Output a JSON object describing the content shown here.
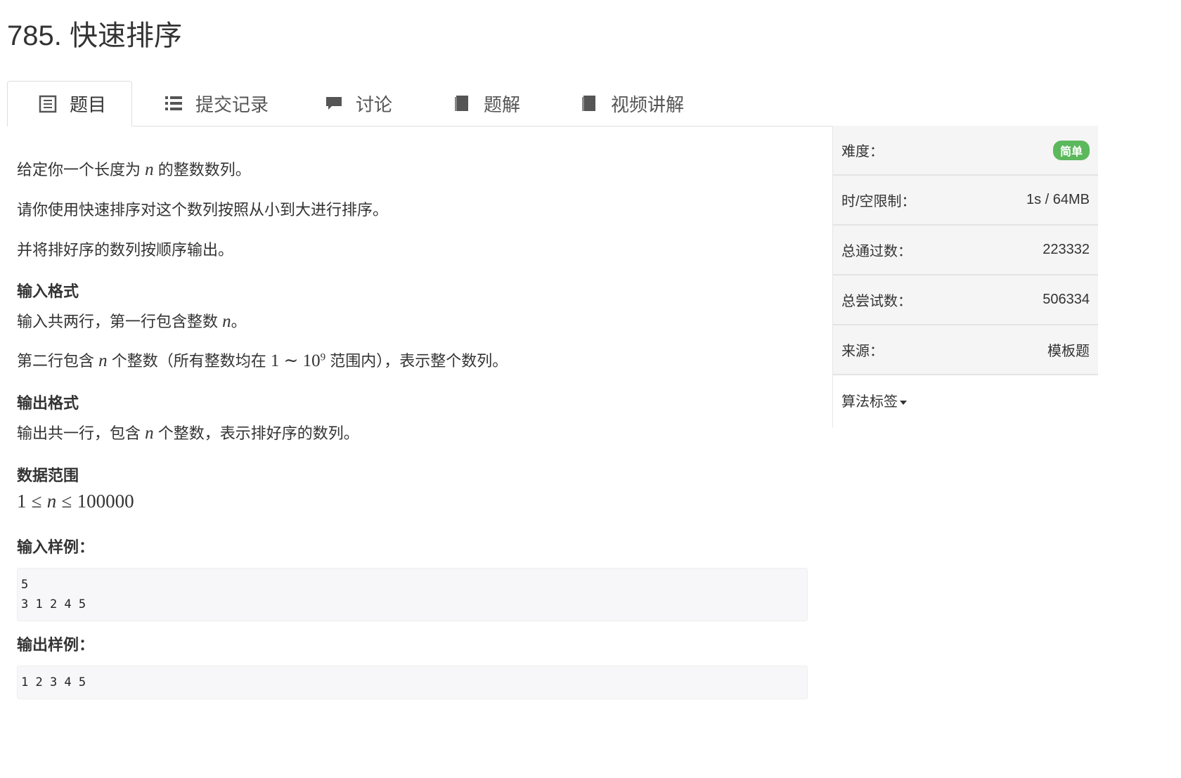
{
  "problem": {
    "title": "785. 快速排序"
  },
  "tabs": [
    {
      "label": "题目",
      "icon": "document-icon"
    },
    {
      "label": "提交记录",
      "icon": "list-icon"
    },
    {
      "label": "讨论",
      "icon": "comment-icon"
    },
    {
      "label": "题解",
      "icon": "book-icon"
    },
    {
      "label": "视频讲解",
      "icon": "book-icon"
    }
  ],
  "description": {
    "p1_before": "给定你一个长度为",
    "p1_var": "n",
    "p1_after": "的整数数列。",
    "p2": "请你使用快速排序对这个数列按照从小到大进行排序。",
    "p3": "并将排好序的数列按顺序输出。"
  },
  "input_format": {
    "heading": "输入格式",
    "line1_before": "输入共两行，第一行包含整数",
    "line1_var": "n",
    "line1_after": "。",
    "line2_before": "第二行包含",
    "line2_var": "n",
    "line2_mid": "个整数（所有整数均在",
    "line2_math_start": "1",
    "line2_math_tilde": "∼",
    "line2_math_base": "10",
    "line2_math_exp": "9",
    "line2_after": "范围内），表示整个数列。"
  },
  "output_format": {
    "heading": "输出格式",
    "line_before": "输出共一行，包含",
    "line_var": "n",
    "line_after": "个整数，表示排好序的数列。"
  },
  "data_range": {
    "heading": "数据范围",
    "math_lo": "1",
    "math_le1": "≤",
    "math_var": "n",
    "math_le2": "≤",
    "math_hi": "100000"
  },
  "sample_input": {
    "heading": "输入样例：",
    "text": "5\n3 1 2 4 5"
  },
  "sample_output": {
    "heading": "输出样例：",
    "text": "1 2 3 4 5"
  },
  "sidebar": {
    "difficulty_label": "难度：",
    "difficulty_value": "简单",
    "difficulty_color": "#5cb85c",
    "limit_label": "时/空限制：",
    "limit_value": "1s / 64MB",
    "passed_label": "总通过数：",
    "passed_value": "223332",
    "attempts_label": "总尝试数：",
    "attempts_value": "506334",
    "source_label": "来源：",
    "source_value": "模板题",
    "tags_label": "算法标签"
  }
}
